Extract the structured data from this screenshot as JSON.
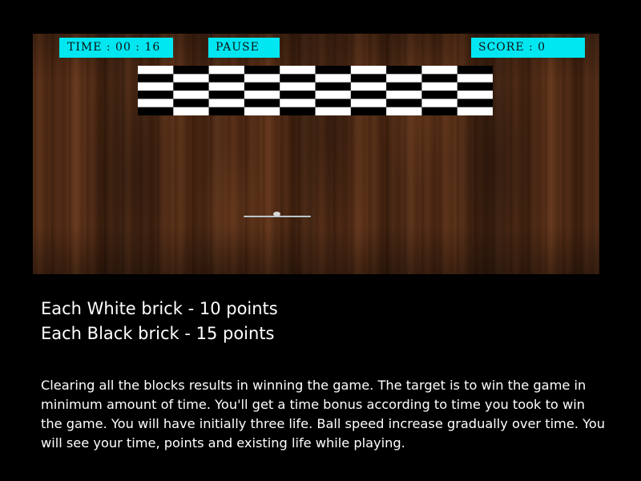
{
  "hud": {
    "time_label": "TIME : 00 : 16",
    "pause_label": "PAUSE",
    "score_label": "SCORE : 0",
    "accent_color": "#00e7f2"
  },
  "bricks": {
    "columns": 10,
    "rows": 6,
    "pattern": "checkerboard",
    "colors": [
      "#ffffff",
      "#000000"
    ]
  },
  "rules": {
    "white_brick": "Each White brick - 10 points",
    "black_brick": "Each Black brick - 15 points"
  },
  "description": "Clearing all the blocks results in winning the game. The target is to win the game in minimum amount of time. You'll get a time bonus according to time you took to win the game. You will have initially three life. Ball speed increase gradually over time. You will see your time, points and existing life while playing."
}
